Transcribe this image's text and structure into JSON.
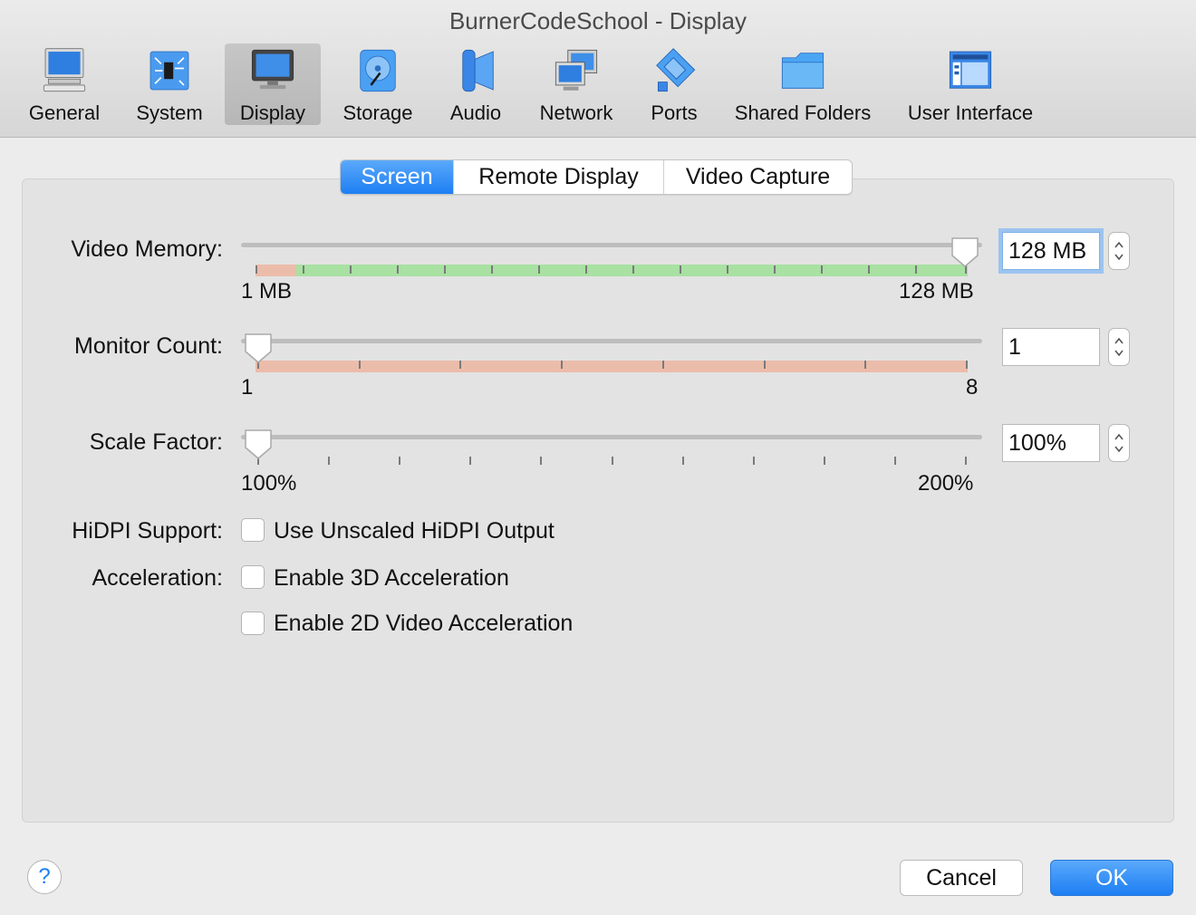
{
  "window": {
    "title": "BurnerCodeSchool - Display"
  },
  "toolbar": {
    "items": [
      {
        "label": "General",
        "icon": "computer-icon"
      },
      {
        "label": "System",
        "icon": "chip-icon"
      },
      {
        "label": "Display",
        "icon": "monitor-icon",
        "selected": true
      },
      {
        "label": "Storage",
        "icon": "disk-icon"
      },
      {
        "label": "Audio",
        "icon": "speaker-icon"
      },
      {
        "label": "Network",
        "icon": "network-icon"
      },
      {
        "label": "Ports",
        "icon": "serial-port-icon"
      },
      {
        "label": "Shared Folders",
        "icon": "folder-icon"
      },
      {
        "label": "User Interface",
        "icon": "window-icon"
      }
    ]
  },
  "tabs": [
    {
      "label": "Screen",
      "active": true
    },
    {
      "label": "Remote Display",
      "active": false
    },
    {
      "label": "Video Capture",
      "active": false
    }
  ],
  "video_memory": {
    "label": "Video Memory:",
    "min_label": "1 MB",
    "max_label": "128 MB",
    "value": "128 MB",
    "level": 1.0
  },
  "monitor_count": {
    "label": "Monitor Count:",
    "min_label": "1",
    "max_label": "8",
    "value": "1",
    "level": 0.0
  },
  "scale_factor": {
    "label": "Scale Factor:",
    "min_label": "100%",
    "max_label": "200%",
    "value": "100%",
    "level": 0.0
  },
  "hidpi": {
    "label": "HiDPI Support:",
    "option": "Use Unscaled HiDPI Output",
    "checked": false
  },
  "acceleration": {
    "label": "Acceleration:",
    "option_3d": "Enable 3D Acceleration",
    "checked_3d": false,
    "option_2d": "Enable 2D Video Acceleration",
    "checked_2d": false
  },
  "footer": {
    "help": "?",
    "cancel": "Cancel",
    "ok": "OK"
  },
  "colors": {
    "accent": "#1d7ef3",
    "band_green": "#a8e1a2",
    "band_red": "#ebbcaa"
  }
}
